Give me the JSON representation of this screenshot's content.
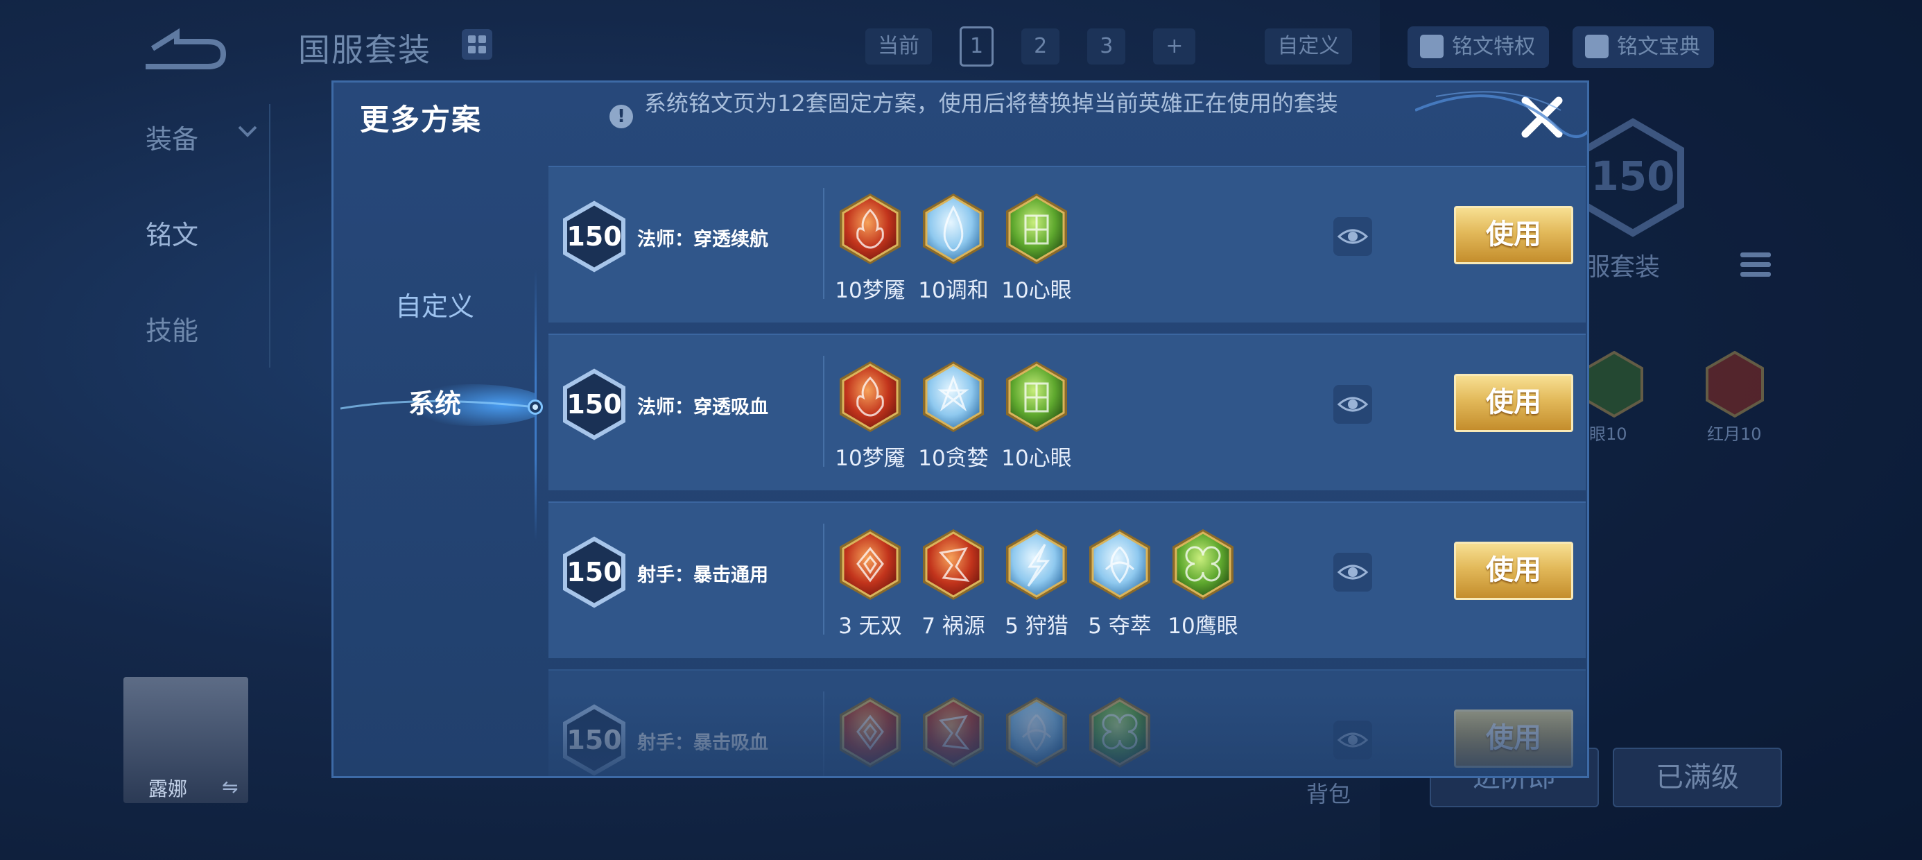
{
  "background": {
    "page_title": "国服套装",
    "sidebar": [
      "装备",
      "铭文",
      "技能"
    ],
    "top_tabs": {
      "current_label": "当前",
      "pages": [
        "1",
        "2",
        "3",
        "+"
      ],
      "custom_label": "自定义"
    },
    "privilege_button": "铭文特权",
    "codex_button": "铭文宝典",
    "right_badge": "150",
    "right_set_name": "服套装",
    "right_gem_labels": [
      "眼10",
      "红月10"
    ],
    "bag_label": "背包",
    "hero_name": "露娜",
    "left_button": "进阶即",
    "maxed_button": "已满级"
  },
  "modal": {
    "title": "更多方案",
    "info": "系统铭文页为12套固定方案，使用后将替换掉当前英雄正在使用的套装",
    "tabs": [
      {
        "label": "自定义",
        "active": false
      },
      {
        "label": "系统",
        "active": true
      }
    ],
    "rows": [
      {
        "badge": "150",
        "name": "法师：穿透续航",
        "gems": [
          {
            "label": "10梦魇",
            "icon": "red-flame-inscription-icon"
          },
          {
            "label": "10调和",
            "icon": "blue-drop-inscription-icon"
          },
          {
            "label": "10心眼",
            "icon": "green-leaf-inscription-icon"
          }
        ],
        "use_label": "使用"
      },
      {
        "badge": "150",
        "name": "法师：穿透吸血",
        "gems": [
          {
            "label": "10梦魇",
            "icon": "red-flame-inscription-icon"
          },
          {
            "label": "10贪婪",
            "icon": "blue-star-inscription-icon"
          },
          {
            "label": "10心眼",
            "icon": "green-leaf-inscription-icon"
          }
        ],
        "use_label": "使用"
      },
      {
        "badge": "150",
        "name": "射手：暴击通用",
        "gems": [
          {
            "label": "3 无双",
            "icon": "red-swirl-inscription-icon"
          },
          {
            "label": "7 祸源",
            "icon": "red-shard-inscription-icon"
          },
          {
            "label": "5 狩猎",
            "icon": "blue-lightning-inscription-icon"
          },
          {
            "label": "5 夺萃",
            "icon": "blue-knot-inscription-icon"
          },
          {
            "label": "10鹰眼",
            "icon": "green-clover-inscription-icon"
          }
        ],
        "use_label": "使用"
      },
      {
        "badge": "150",
        "name": "射手：暴击吸血",
        "gems": [
          {
            "label": "",
            "icon": "red-swirl-inscription-icon"
          },
          {
            "label": "",
            "icon": "red-shard-inscription-icon"
          },
          {
            "label": "",
            "icon": "blue-knot-inscription-icon"
          },
          {
            "label": "",
            "icon": "green-clover-inscription-icon"
          }
        ],
        "use_label": "使用"
      }
    ]
  },
  "colors": {
    "red": [
      "#f6a25a",
      "#c2341c",
      "#7a1a10"
    ],
    "blue": [
      "#e6f6ff",
      "#8fc9ef",
      "#3c7bb0"
    ],
    "green": [
      "#c9ee7d",
      "#5ea82e",
      "#2c5a17"
    ],
    "gold": "#d9b45c"
  }
}
